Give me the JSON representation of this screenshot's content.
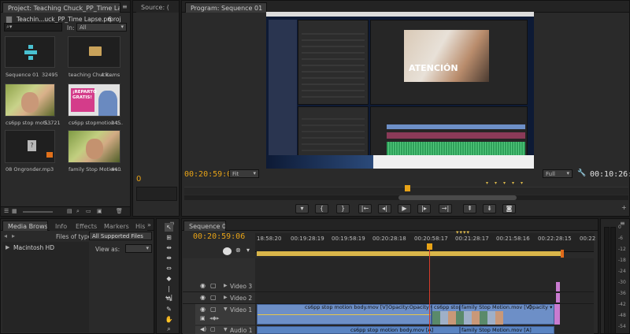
{
  "project": {
    "tab_title": "Project: Teaching Chuck_PP_Time Lapse",
    "source_tab": "Source: (",
    "file_name": "Teachin...uck_PP_Time Lapse.prproj",
    "item_count": "6 Items",
    "in_label": "In:",
    "in_value": "All",
    "items": [
      {
        "name": "Sequence 01",
        "meta": "32495"
      },
      {
        "name": "teaching Chuck...",
        "meta": "4 items"
      },
      {
        "name": "cs6pp stop moti...",
        "meta": "53721"
      },
      {
        "name": "cs6pp stopmotion t...",
        "meta": "245"
      },
      {
        "name": "08 Ongronder.mp3",
        "meta": ""
      },
      {
        "name": "family Stop Motion...",
        "meta": "440"
      }
    ],
    "thumb_overlay": "¡REPARTO\nGRATIS!"
  },
  "source": {
    "value": "0"
  },
  "program": {
    "tab_title": "Program: Sequence 01",
    "timecode_left": "00:20:59:06",
    "fit_label": "Fit",
    "full_label": "Full",
    "timecode_right": "00:10:26:08",
    "nested_text": "ATENCIÓN"
  },
  "media_browser": {
    "tabs": [
      "Media Browser",
      "Info",
      "Effects",
      "Markers",
      "His"
    ],
    "files_of_type_label": "Files of type:",
    "files_of_type_value": "All Supported Files",
    "drive": "Macintosh HD",
    "view_as_label": "View as:"
  },
  "timeline": {
    "tab_title": "Sequence 01",
    "timecode": "00:20:59:06",
    "ruler": [
      "18:58:20",
      "00:19:28:19",
      "00:19:58:19",
      "00:20:28:18",
      "00:20:58:17",
      "00:21:28:17",
      "00:21:58:16",
      "00:22:28:15",
      "00:22"
    ],
    "tracks": {
      "video3": "Video 3",
      "video2": "Video 2",
      "video1": "Video 1",
      "audio1": "Audio 1"
    },
    "clips": {
      "v1_a": "cs6pp stop motion body.mov [V]",
      "v1_a_fx": "Opacity:Opacity ▾",
      "v1_b": "cs6pp stop",
      "v1_c": "family Stop Motion.mov [V]",
      "v1_c_fx": "Opacity ▾",
      "a1_a": "cs6pp stop motion body.mov [A]",
      "a1_b": "family Stop Motion.mov [A]"
    }
  },
  "audio_meter": {
    "scale": [
      "0",
      "-6",
      "-12",
      "-18",
      "-24",
      "-30",
      "-36",
      "-42",
      "-48",
      "-54"
    ]
  },
  "colors": {
    "accent": "#e8a317",
    "playhead": "#d63c2a",
    "clip_video": "#6d8fc7",
    "clip_audio": "#5a84c2",
    "work_area": "#d9b64a"
  }
}
